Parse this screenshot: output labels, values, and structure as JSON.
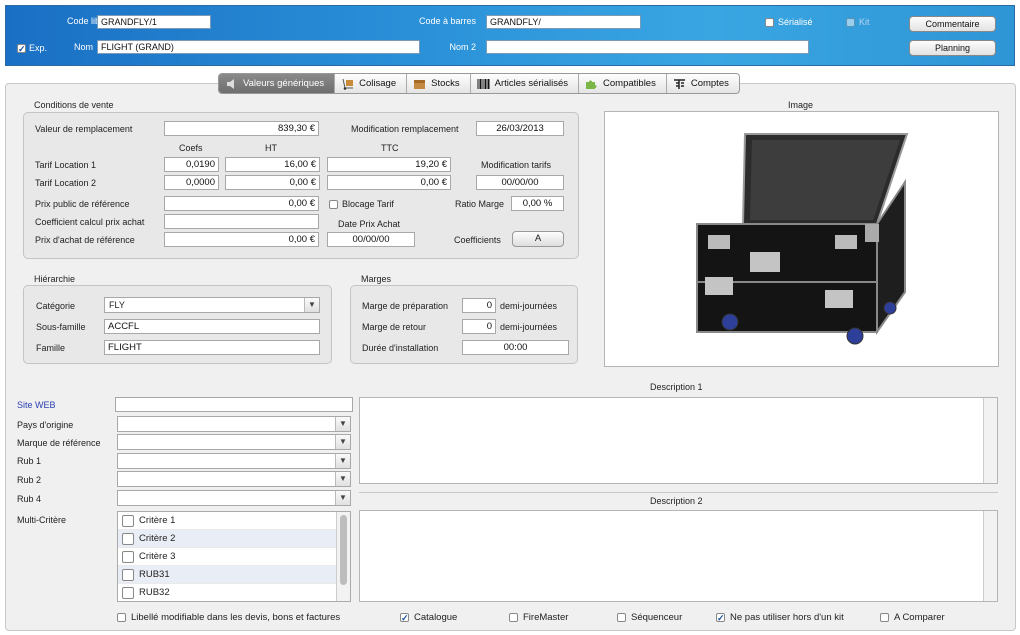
{
  "header": {
    "code_libre_label": "Code libre",
    "code_libre_value": "GRANDFLY/1",
    "code_barres_label": "Code à barres",
    "code_barres_value": "GRANDFLY/",
    "exp_label": "Exp.",
    "nom_label": "Nom",
    "nom_value": "FLIGHT (GRAND)",
    "nom2_label": "Nom 2",
    "nom2_value": "",
    "serialise_label": "Sérialisé",
    "kit_label": "Kit",
    "commentaire_button": "Commentaire",
    "planning_button": "Planning"
  },
  "tabs": [
    {
      "label": "Valeurs génériques",
      "icon": "speaker-icon",
      "active": true
    },
    {
      "label": "Colisage",
      "icon": "hand-truck-icon"
    },
    {
      "label": "Stocks",
      "icon": "box-icon"
    },
    {
      "label": "Articles sérialisés",
      "icon": "barcode-icon"
    },
    {
      "label": "Compatibles",
      "icon": "puzzle-icon"
    },
    {
      "label": "Comptes",
      "icon": "accounts-icon"
    }
  ],
  "conditions": {
    "title": "Conditions de vente",
    "valeur_remplacement_label": "Valeur de remplacement",
    "valeur_remplacement": "839,30 €",
    "modif_remplacement_label": "Modification remplacement",
    "modif_remplacement": "26/03/2013",
    "coefs_label": "Coefs",
    "ht_label": "HT",
    "ttc_label": "TTC",
    "tarif1_label": "Tarif Location 1",
    "tarif1_coef": "0,0190",
    "tarif1_ht": "16,00 €",
    "tarif1_ttc": "19,20 €",
    "modif_tarifs_label": "Modification tarifs",
    "modif_tarifs": "00/00/00",
    "tarif2_label": "Tarif Location 2",
    "tarif2_coef": "0,0000",
    "tarif2_ht": "0,00 €",
    "tarif2_ttc": "0,00 €",
    "prix_public_label": "Prix public de référence",
    "prix_public": "0,00 €",
    "blocage_label": "Blocage Tarif",
    "ratio_label": "Ratio Marge",
    "ratio": "0,00 %",
    "coef_calc_label": "Coefficient calcul prix achat",
    "coef_calc": "",
    "date_prix_label": "Date Prix Achat",
    "prix_achat_label": "Prix d'achat de référence",
    "prix_achat": "0,00 €",
    "date_prix": "00/00/00",
    "coefficients_label": "Coefficients",
    "coefficients_button": "A"
  },
  "image": {
    "title": "Image",
    "description": "Black flight case on wheels with open lid"
  },
  "hierarchie": {
    "title": "Hiérarchie",
    "categorie_label": "Catégorie",
    "categorie": "FLY",
    "sous_famille_label": "Sous-famille",
    "sous_famille": "ACCFL",
    "famille_label": "Famille",
    "famille": "FLIGHT"
  },
  "marges": {
    "title": "Marges",
    "prep_label": "Marge de préparation",
    "prep": "0",
    "prep_unit": "demi-journées",
    "retour_label": "Marge de retour",
    "retour": "0",
    "retour_unit": "demi-journées",
    "install_label": "Durée d'installation",
    "install": "00:00"
  },
  "left": {
    "site_label": "Site WEB",
    "pays_label": "Pays d'origine",
    "marque_label": "Marque de référence",
    "rub1_label": "Rub 1",
    "rub2_label": "Rub 2",
    "rub4_label": "Rub 4",
    "multi_label": "Multi-Critère",
    "criteria": [
      "Critère 1",
      "Critère 2",
      "Critère 3",
      "RUB31",
      "RUB32"
    ]
  },
  "desc": {
    "d1_title": "Description 1",
    "d2_title": "Description 2"
  },
  "footer": {
    "libelle_label": "Libellé modifiable dans les devis, bons et factures",
    "catalogue_label": "Catalogue",
    "firemaster_label": "FireMaster",
    "sequenceur_label": "Séquenceur",
    "ne_pas_label": "Ne pas utiliser hors d'un kit",
    "comparer_label": "A Comparer"
  },
  "colors": {
    "header_blue": "#2a90d8",
    "active_tab": "#7a7a7a",
    "link_blue": "#2a3fb0"
  }
}
